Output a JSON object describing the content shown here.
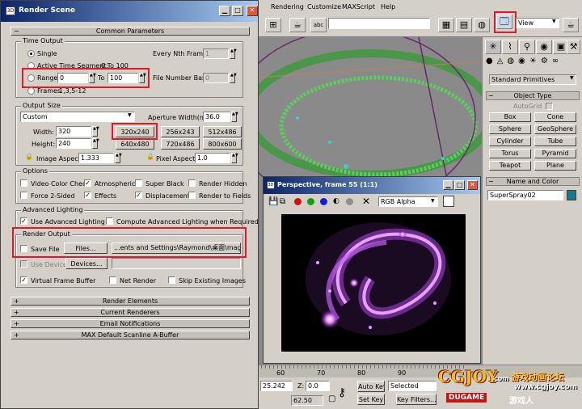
{
  "render_scene": {
    "title": "Render Scene",
    "common_parameters": "Common Parameters",
    "time_output": {
      "group": "Time Output",
      "single": "Single",
      "every_nth_label": "Every Nth Frame:",
      "every_nth_value": "1",
      "active_segment": "Active Time Segment:",
      "active_segment_value": "0 To 100",
      "range": "Range:",
      "range_from": "0",
      "to": "To",
      "range_to": "100",
      "file_number_base_label": "File Number Base:",
      "file_number_base_value": "0",
      "frames": "Frames",
      "frames_value": "1,3,5-12"
    },
    "output_size": {
      "group": "Output Size",
      "preset": "Custom",
      "aperture_label": "Aperture Width(mm):",
      "aperture_value": "36.0",
      "width_label": "Width:",
      "width_value": "320",
      "height_label": "Height:",
      "height_value": "240",
      "presets": [
        "320x240",
        "256x243",
        "512x486",
        "640x480",
        "720x486",
        "800x600"
      ],
      "image_aspect_label": "Image Aspect:",
      "image_aspect_value": "1.333",
      "pixel_aspect_label": "Pixel Aspect:",
      "pixel_aspect_value": "1.0"
    },
    "options": {
      "group": "Options",
      "video_color_check": "Video Color Check",
      "atmospherics": "Atmospherics",
      "super_black": "Super Black",
      "render_hidden": "Render Hidden",
      "force_2sided": "Force 2-Sided",
      "effects": "Effects",
      "displacement": "Displacement",
      "render_to_fields": "Render to Fields"
    },
    "advanced_lighting": {
      "group": "Advanced Lighting",
      "use": "Use Advanced Lighting",
      "compute": "Compute Advanced Lighting when Required"
    },
    "render_output": {
      "group": "Render Output",
      "save_file": "Save File",
      "files_button": "Files...",
      "path": "...ents and Settings\\Raymond\\桌面\\magic.avi",
      "use_device": "Use Device",
      "devices_button": "Devices...",
      "virtual_frame_buffer": "Virtual Frame Buffer",
      "net_render": "Net Render",
      "skip_existing": "Skip Existing Images"
    },
    "rollouts": [
      "Render Elements",
      "Current Renderers",
      "Email Notifications",
      "MAX Default Scanline A-Buffer"
    ]
  },
  "menu": [
    "Rendering",
    "Customize",
    "MAXScript",
    "Help"
  ],
  "viewport_dropdown": "View",
  "command_panel": {
    "category": "Standard Primitives",
    "object_type": "Object Type",
    "autogrid": "AutoGrid",
    "objects": [
      "Box",
      "Cone",
      "Sphere",
      "GeoSphere",
      "Cylinder",
      "Tube",
      "Torus",
      "Pyramid",
      "Teapot",
      "Plane"
    ],
    "name_and_color": "Name and Color",
    "object_name": "SuperSpray02",
    "object_color": "#1a7a8a"
  },
  "frame_window": {
    "title": "Perspective, frame 55 (1:1)",
    "channel": "RGB Alpha"
  },
  "timeline": {
    "ticks": [
      "60",
      "70",
      "80",
      "90"
    ],
    "coord_x": "25.242",
    "z_label": "Z:",
    "z_value": "0.0",
    "grid": "62.50",
    "auto_key": "Auto Key",
    "set_key": "Set Key",
    "key_mode": "Selected",
    "key_filters": "Key Filters..."
  },
  "watermark": {
    "logo": "CGJOY",
    "logo_com": ".com",
    "cn": "游戏动画论坛",
    "url": "www.cgjoy.com",
    "dugame": "DUGAME",
    "dugame_cn": "游戏人"
  }
}
